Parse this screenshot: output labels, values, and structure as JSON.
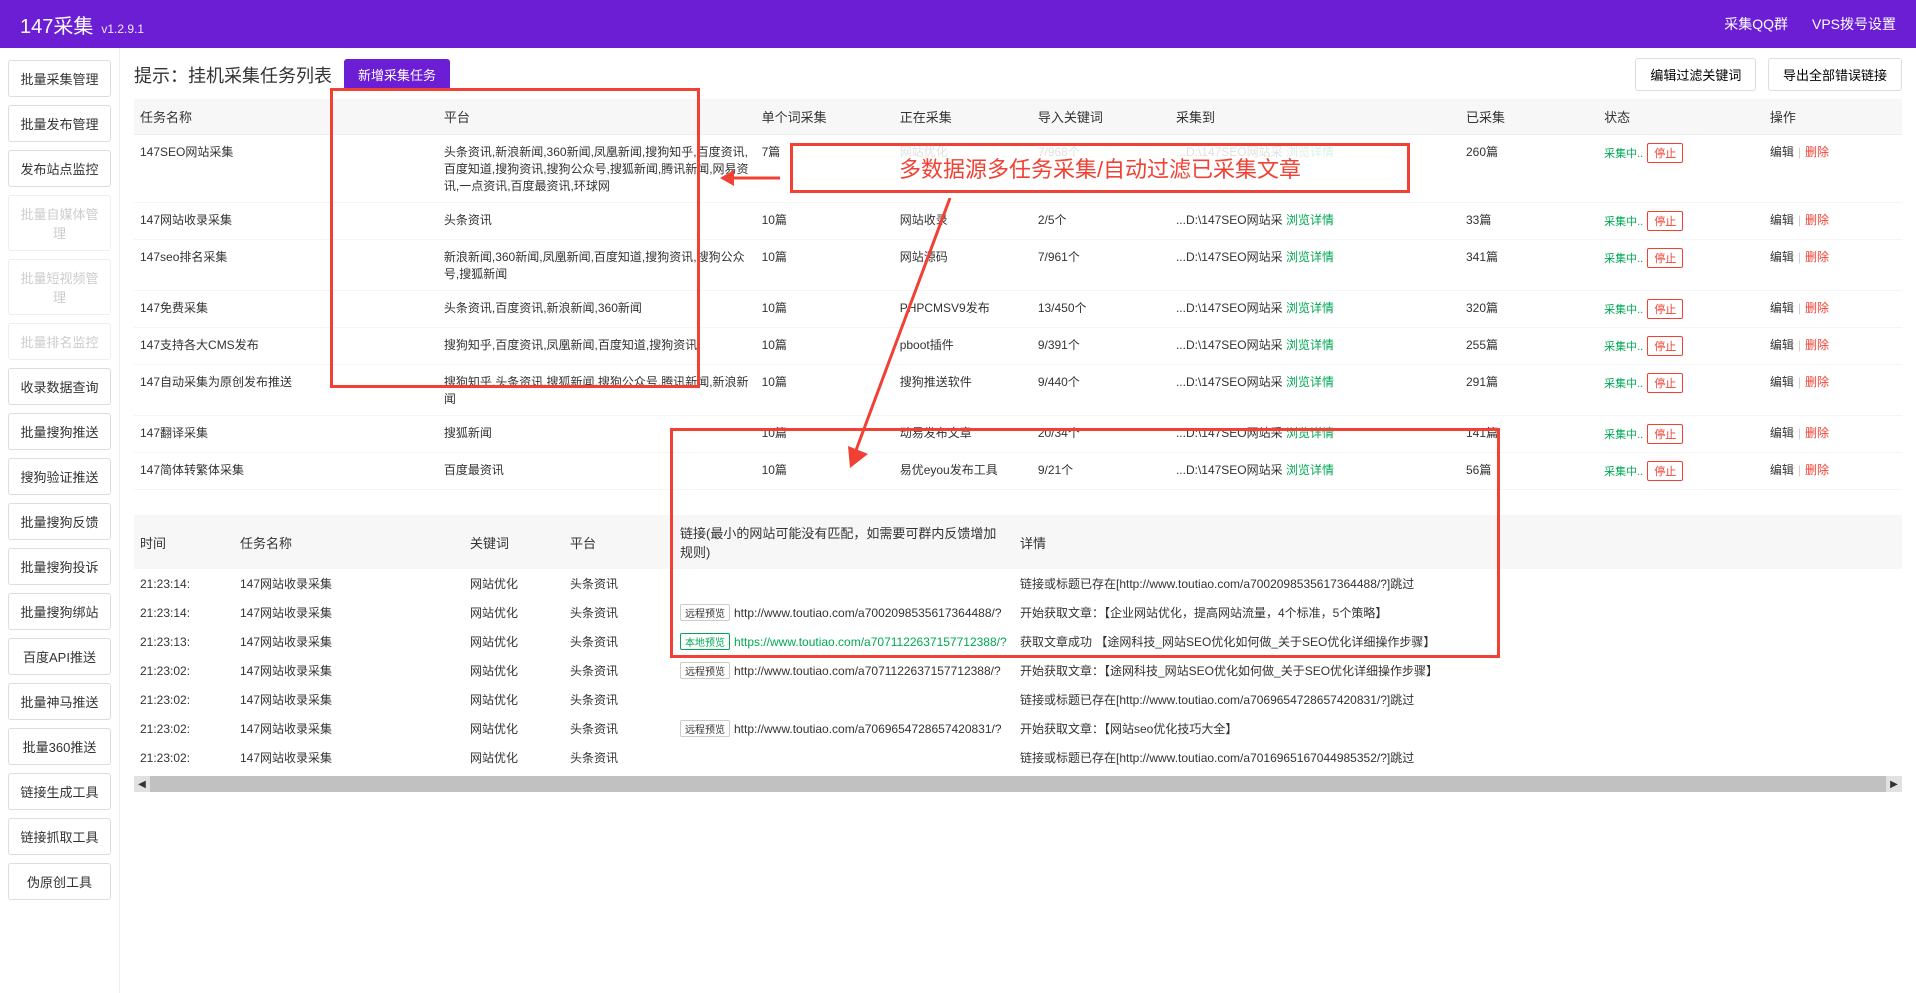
{
  "header": {
    "title": "147采集",
    "version": "v1.2.9.1",
    "link_qq": "采集QQ群",
    "link_vps": "VPS拨号设置"
  },
  "sidebar": {
    "items": [
      {
        "label": "批量采集管理",
        "disabled": false
      },
      {
        "label": "批量发布管理",
        "disabled": false
      },
      {
        "label": "发布站点监控",
        "disabled": false
      },
      {
        "label": "批量自媒体管理",
        "disabled": true
      },
      {
        "label": "批量短视频管理",
        "disabled": true
      },
      {
        "label": "批量排名监控",
        "disabled": true
      },
      {
        "label": "收录数据查询",
        "disabled": false
      },
      {
        "label": "批量搜狗推送",
        "disabled": false
      },
      {
        "label": "搜狗验证推送",
        "disabled": false
      },
      {
        "label": "批量搜狗反馈",
        "disabled": false
      },
      {
        "label": "批量搜狗投诉",
        "disabled": false
      },
      {
        "label": "批量搜狗绑站",
        "disabled": false
      },
      {
        "label": "百度API推送",
        "disabled": false
      },
      {
        "label": "批量神马推送",
        "disabled": false
      },
      {
        "label": "批量360推送",
        "disabled": false
      },
      {
        "label": "链接生成工具",
        "disabled": false
      },
      {
        "label": "链接抓取工具",
        "disabled": false
      },
      {
        "label": "伪原创工具",
        "disabled": false
      }
    ]
  },
  "topPanel": {
    "title": "提示：挂机采集任务列表",
    "addBtn": "新增采集任务",
    "filterBtn": "编辑过滤关键词",
    "exportBtn": "导出全部错误链接",
    "columns": {
      "name": "任务名称",
      "platform": "平台",
      "single": "单个词采集",
      "collecting": "正在采集",
      "keywords": "导入关键词",
      "target": "采集到",
      "collected": "已采集",
      "status": "状态",
      "action": "操作"
    },
    "rows": [
      {
        "name": "147SEO网站采集",
        "platform": "头条资讯,新浪新闻,360新闻,凤凰新闻,搜狗知乎,百度资讯,百度知道,搜狗资讯,搜狗公众号,搜狐新闻,腾讯新闻,网易资讯,一点资讯,百度最资讯,环球网",
        "single": "7篇",
        "collecting": "网站优化",
        "keywords": "7/968个",
        "target": "...D:\\147SEO网站采",
        "collected": "260篇"
      },
      {
        "name": "147网站收录采集",
        "platform": "头条资讯",
        "single": "10篇",
        "collecting": "网站收录",
        "keywords": "2/5个",
        "target": "...D:\\147SEO网站采",
        "collected": "33篇"
      },
      {
        "name": "147seo排名采集",
        "platform": "新浪新闻,360新闻,凤凰新闻,百度知道,搜狗资讯,搜狗公众号,搜狐新闻",
        "single": "10篇",
        "collecting": "网站源码",
        "keywords": "7/961个",
        "target": "...D:\\147SEO网站采",
        "collected": "341篇"
      },
      {
        "name": "147免费采集",
        "platform": "头条资讯,百度资讯,新浪新闻,360新闻",
        "single": "10篇",
        "collecting": "PHPCMSV9发布",
        "keywords": "13/450个",
        "target": "...D:\\147SEO网站采",
        "collected": "320篇"
      },
      {
        "name": "147支持各大CMS发布",
        "platform": "搜狗知乎,百度资讯,凤凰新闻,百度知道,搜狗资讯",
        "single": "10篇",
        "collecting": "pboot插件",
        "keywords": "9/391个",
        "target": "...D:\\147SEO网站采",
        "collected": "255篇"
      },
      {
        "name": "147自动采集为原创发布推送",
        "platform": "搜狗知乎,头条资讯,搜狐新闻,搜狗公众号,腾讯新闻,新浪新闻",
        "single": "10篇",
        "collecting": "搜狗推送软件",
        "keywords": "9/440个",
        "target": "...D:\\147SEO网站采",
        "collected": "291篇"
      },
      {
        "name": "147翻译采集",
        "platform": "搜狐新闻",
        "single": "10篇",
        "collecting": "动易发布文章",
        "keywords": "20/34个",
        "target": "...D:\\147SEO网站采",
        "collected": "141篇"
      },
      {
        "name": "147简体转繁体采集",
        "platform": "百度最资讯",
        "single": "10篇",
        "collecting": "易优eyou发布工具",
        "keywords": "9/21个",
        "target": "...D:\\147SEO网站采",
        "collected": "56篇"
      }
    ],
    "viewDetail": "浏览详情",
    "statusText": "采集中..",
    "stopBtn": "停止",
    "editBtn": "编辑",
    "deleteBtn": "删除"
  },
  "callout": "多数据源多任务采集/自动过滤已采集文章",
  "logPanel": {
    "columns": {
      "time": "时间",
      "task": "任务名称",
      "keyword": "关键词",
      "platform": "平台",
      "link": "链接(最小的网站可能没有匹配，如需要可群内反馈增加规则)",
      "detail": "详情"
    },
    "rows": [
      {
        "time": "21:23:14:",
        "task": "147网站收录采集",
        "keyword": "网站优化",
        "platform": "头条资讯",
        "linkType": "",
        "link": "",
        "detail": "链接或标题已存在[http://www.toutiao.com/a7002098535617364488/?]跳过"
      },
      {
        "time": "21:23:14:",
        "task": "147网站收录采集",
        "keyword": "网站优化",
        "platform": "头条资讯",
        "linkType": "remote",
        "link": "http://www.toutiao.com/a7002098535617364488/?",
        "detail": "开始获取文章：【企业网站优化，提高网站流量，4个标准，5个策略】"
      },
      {
        "time": "21:23:13:",
        "task": "147网站收录采集",
        "keyword": "网站优化",
        "platform": "头条资讯",
        "linkType": "local",
        "link": "https://www.toutiao.com/a7071122637157712388/?",
        "detail": "获取文章成功 【途网科技_网站SEO优化如何做_关于SEO优化详细操作步骤】"
      },
      {
        "time": "21:23:02:",
        "task": "147网站收录采集",
        "keyword": "网站优化",
        "platform": "头条资讯",
        "linkType": "remote",
        "link": "http://www.toutiao.com/a7071122637157712388/?",
        "detail": "开始获取文章：【途网科技_网站SEO优化如何做_关于SEO优化详细操作步骤】"
      },
      {
        "time": "21:23:02:",
        "task": "147网站收录采集",
        "keyword": "网站优化",
        "platform": "头条资讯",
        "linkType": "",
        "link": "",
        "detail": "链接或标题已存在[http://www.toutiao.com/a7069654728657420831/?]跳过"
      },
      {
        "time": "21:23:02:",
        "task": "147网站收录采集",
        "keyword": "网站优化",
        "platform": "头条资讯",
        "linkType": "remote",
        "link": "http://www.toutiao.com/a7069654728657420831/?",
        "detail": "开始获取文章：【网站seo优化技巧大全】"
      },
      {
        "time": "21:23:02:",
        "task": "147网站收录采集",
        "keyword": "网站优化",
        "platform": "头条资讯",
        "linkType": "",
        "link": "",
        "detail": "链接或标题已存在[http://www.toutiao.com/a7016965167044985352/?]跳过"
      }
    ],
    "tagRemote": "远程预览",
    "tagLocal": "本地预览"
  }
}
